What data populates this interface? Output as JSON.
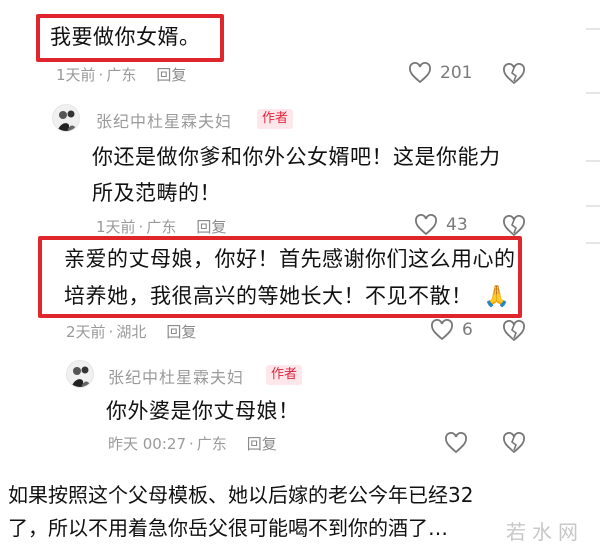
{
  "comments": [
    {
      "text": "我要做你女婿。",
      "meta_time": "1天前",
      "meta_sep": "·",
      "meta_loc": "广东",
      "reply_label": "回复",
      "likes": "201"
    },
    {
      "author": "张纪中杜星霖夫妇",
      "badge": "作者",
      "line1": "你还是做你爹和你外公女婿吧！这是你能力",
      "line2": "所及范畴的！",
      "meta_time": "1天前",
      "meta_sep": "·",
      "meta_loc": "广东",
      "reply_label": "回复",
      "likes": "43"
    },
    {
      "line1": "亲爱的丈母娘，你好！首先感谢你们这么用心的",
      "line2": "培养她，我很高兴的等她长大！不见不散！",
      "emoji": "🙏",
      "meta_time": "2天前",
      "meta_sep": "·",
      "meta_loc": "湖北",
      "reply_label": "回复",
      "likes": "6"
    },
    {
      "author": "张纪中杜星霖夫妇",
      "badge": "作者",
      "text": "你外婆是你丈母娘！",
      "meta_time": "昨天 00:27",
      "meta_sep": "·",
      "meta_loc": "广东",
      "reply_label": "回复"
    }
  ],
  "bottom": {
    "line1": "如果按照这个父母模板、她以后嫁的老公今年已经32",
    "line2": "了，所以不用着急你岳父很可能喝不到你的酒了…"
  },
  "watermark": "若水网",
  "colors": {
    "highlight": "#e0262d",
    "badge_bg": "#fde7ea",
    "badge_text": "#e0263d"
  }
}
